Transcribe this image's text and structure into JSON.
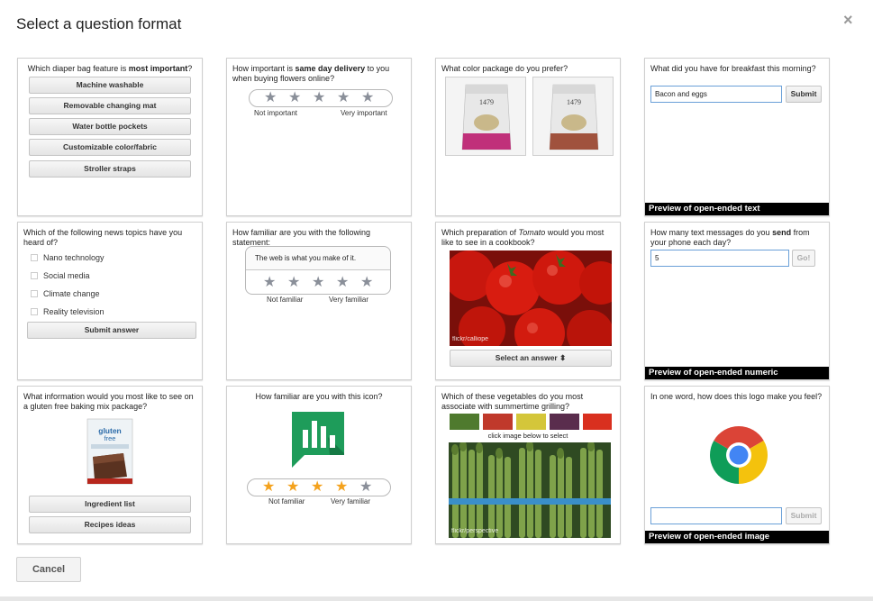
{
  "dialog": {
    "title": "Select a question format",
    "close_glyph": "×",
    "cancel_label": "Cancel"
  },
  "cards": {
    "diaper": {
      "question_pre": "Which diaper bag feature is ",
      "question_bold": "most important",
      "question_post": "?",
      "options": [
        "Machine washable",
        "Removable changing mat",
        "Water bottle pockets",
        "Customizable color/fabric",
        "Stroller straps"
      ]
    },
    "delivery": {
      "question_pre": "How important is ",
      "question_bold": "same day delivery",
      "question_post": " to you when buying flowers online?",
      "low_label": "Not important",
      "high_label": "Very important",
      "rating": 0
    },
    "color": {
      "question": "What color package do you prefer?",
      "pkg_text": "1479",
      "colors": [
        "#c0307a",
        "#a0523d"
      ]
    },
    "breakfast": {
      "question": "What did you have for breakfast this morning?",
      "input_value": "Bacon and eggs",
      "submit_label": "Submit",
      "preview_label": "Preview of open-ended text"
    },
    "news": {
      "question": "Which of the following news topics have you heard of?",
      "options": [
        "Nano technology",
        "Social media",
        "Climate change",
        "Reality television"
      ],
      "submit_label": "Submit answer"
    },
    "familiar_statement": {
      "question": "How familiar are you with the following statement:",
      "statement": "The web is what you make of it.",
      "low_label": "Not familiar",
      "high_label": "Very familiar",
      "rating": 0
    },
    "tomato": {
      "question_pre": "Which preparation of ",
      "question_italic": "Tomato",
      "question_post": " would you most like to see in a cookbook?",
      "credit": "flickr/calliope",
      "select_label": "Select an answer ⬍"
    },
    "texts": {
      "question_pre": "How many text messages do you ",
      "question_bold": "send",
      "question_post": " from your phone each day?",
      "input_value": "5",
      "go_label": "Go!",
      "preview_label": "Preview of open-ended numeric"
    },
    "gluten": {
      "question": "What information would you most like to see on a gluten free baking mix package?",
      "box_brand": "gluten",
      "box_brand2": "free",
      "options": [
        "Ingredient list",
        "Recipes ideas"
      ]
    },
    "icon": {
      "question": "How familiar are you with this icon?",
      "low_label": "Not familiar",
      "high_label": "Very familiar",
      "rating": 4
    },
    "vegetables": {
      "question": "Which of these vegetables do you most associate with summertime grilling?",
      "hint": "click image below to select",
      "credit": "flickr/perspective",
      "thumb_colors": [
        "#4f7a2e",
        "#c0392b",
        "#d4c63a",
        "#5a2d4d",
        "#d9301f"
      ]
    },
    "logo": {
      "question": "In one word, how does this logo make you feel?",
      "input_value": "",
      "submit_label": "Submit",
      "preview_label": "Preview of open-ended image"
    }
  }
}
